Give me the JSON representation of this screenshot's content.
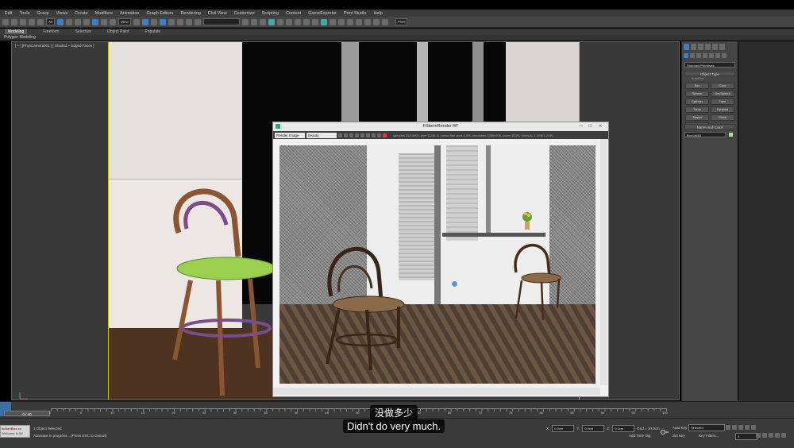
{
  "menu": [
    "Edit",
    "Tools",
    "Group",
    "Views",
    "Create",
    "Modifiers",
    "Animation",
    "Graph Editors",
    "Rendering",
    "Civil View",
    "Customize",
    "Scripting",
    "Content",
    "GameExporter",
    "Print Studio",
    "Help"
  ],
  "toolbar": {
    "selection_filter": "All",
    "ref_coord": "View",
    "pixel_label": "Pixel"
  },
  "ribbon": {
    "tabs": [
      "Modeling",
      "Freeform",
      "Selection",
      "Object Paint",
      "Populate"
    ],
    "active_tab": "Modeling",
    "sub_label": "Polygon Modeling"
  },
  "viewport": {
    "label": "[ + ] [PhysCamera001 ] [ Shaded + Edged Faces ]"
  },
  "render_window": {
    "title": "FStormRender RT",
    "channel_select": "Render Image",
    "mode_select": "beauty",
    "stats": "samples 31/10000, time 11/30:11, noise free area 0.0%, resolution 1000x700, zoom 100%, memory 1.1GB/1.2GB"
  },
  "command_panel": {
    "dropdown": "Standard Primitives",
    "object_type_header": "Object Type",
    "autogrid_label": "AutoGrid",
    "buttons": [
      "Box",
      "Cone",
      "Sphere",
      "GeoSphere",
      "Cylinder",
      "Tube",
      "Torus",
      "Pyramid",
      "Teapot",
      "Plane",
      "TextPlus"
    ],
    "name_color_header": "Name and Color",
    "name_value": "Box14654"
  },
  "timeline": {
    "frame_display": "0 / 40",
    "ticks": [
      "0",
      "5",
      "10",
      "15",
      "20",
      "25",
      "30",
      "35",
      "40",
      "45",
      "50",
      "55",
      "60",
      "65",
      "70",
      "75",
      "80",
      "85",
      "90",
      "95",
      "100"
    ]
  },
  "status": {
    "selection": "1 Object Selected",
    "prompt": "Autosave in progress... (Press ESC to Cancel)",
    "logo_line1": "actionBox.xx",
    "logo_line2": "Welcome to MI",
    "x_label": "X:",
    "x_value": "0.0cm",
    "y_label": "Y:",
    "y_value": "0.0cm",
    "z_label": "Z:",
    "z_value": "0.0cm",
    "grid": "Grid = 10.0cm",
    "add_time_tag": "Add Time Tag",
    "auto_key": "Auto Key",
    "set_key": "Set Key",
    "key_mode": "Selected",
    "key_filters": "Key Filters...",
    "frame_num": "0"
  },
  "subtitles": {
    "zh": "没做多少",
    "en": "Didn't do very much."
  },
  "colors": {
    "accent_blue": "#3d7ec4",
    "viewport_border": "#c8c000",
    "swatch": "#aee37a"
  }
}
